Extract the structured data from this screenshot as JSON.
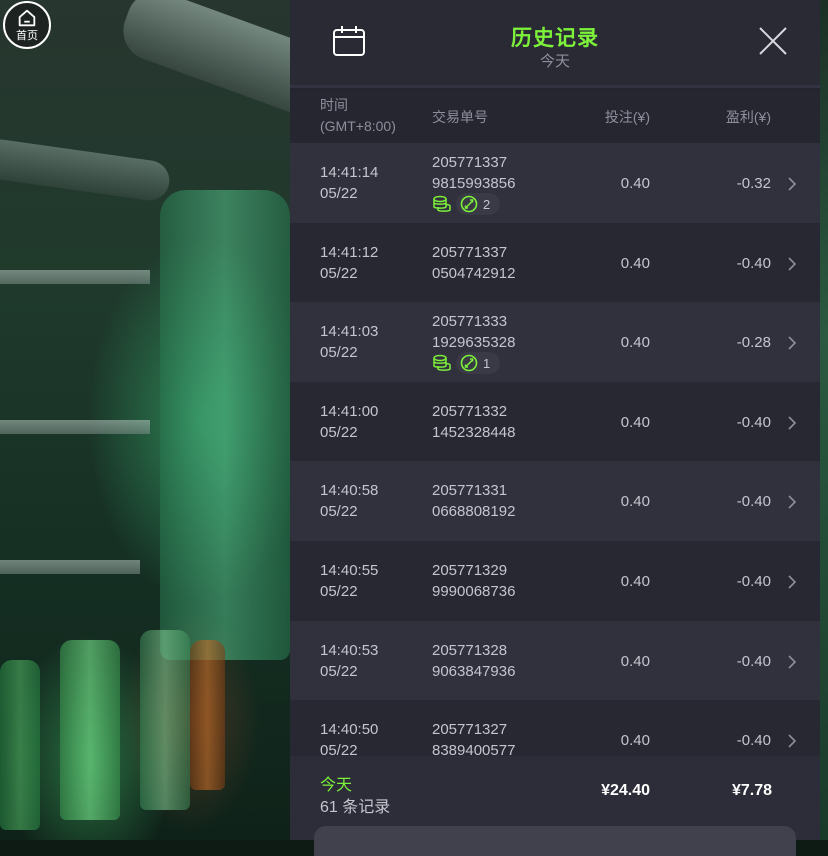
{
  "home": {
    "label": "首页",
    "icon": "home-icon"
  },
  "header": {
    "title": "历史记录",
    "subtitle": "今天",
    "calendar_icon": "calendar-icon",
    "close_icon": "close-icon",
    "accent_color": "#7cf23a"
  },
  "columns": {
    "time_line1": "时间",
    "time_line2": "(GMT+8:00)",
    "order": "交易单号",
    "bet": "投注(¥)",
    "profit": "盈利(¥)"
  },
  "rows": [
    {
      "time": "14:41:14",
      "date": "05/22",
      "order1": "205771337",
      "order2": "9815993856",
      "bet": "0.40",
      "profit": "-0.32",
      "badge": "2"
    },
    {
      "time": "14:41:12",
      "date": "05/22",
      "order1": "205771337",
      "order2": "0504742912",
      "bet": "0.40",
      "profit": "-0.40"
    },
    {
      "time": "14:41:03",
      "date": "05/22",
      "order1": "205771333",
      "order2": "1929635328",
      "bet": "0.40",
      "profit": "-0.28",
      "badge": "1"
    },
    {
      "time": "14:41:00",
      "date": "05/22",
      "order1": "205771332",
      "order2": "1452328448",
      "bet": "0.40",
      "profit": "-0.40"
    },
    {
      "time": "14:40:58",
      "date": "05/22",
      "order1": "205771331",
      "order2": "0668808192",
      "bet": "0.40",
      "profit": "-0.40"
    },
    {
      "time": "14:40:55",
      "date": "05/22",
      "order1": "205771329",
      "order2": "9990068736",
      "bet": "0.40",
      "profit": "-0.40"
    },
    {
      "time": "14:40:53",
      "date": "05/22",
      "order1": "205771328",
      "order2": "9063847936",
      "bet": "0.40",
      "profit": "-0.40"
    },
    {
      "time": "14:40:50",
      "date": "05/22",
      "order1": "205771327",
      "order2": "8389400577",
      "bet": "0.40",
      "profit": "-0.40"
    }
  ],
  "footer": {
    "today": "今天",
    "count": "61 条记录",
    "total_bet": "¥24.40",
    "total_profit": "¥7.78"
  }
}
